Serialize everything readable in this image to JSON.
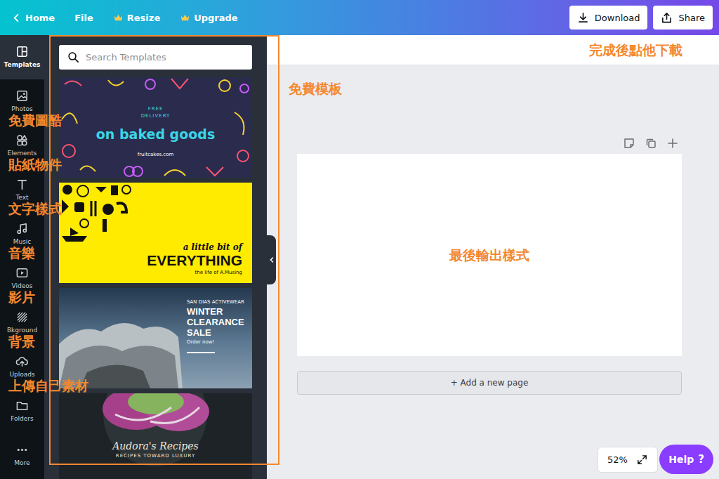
{
  "topbar": {
    "nav": [
      {
        "label": "Home",
        "kind": "back"
      },
      {
        "label": "File",
        "kind": "plain"
      },
      {
        "label": "Resize",
        "kind": "premium"
      },
      {
        "label": "Upgrade",
        "kind": "premium"
      }
    ],
    "actions": [
      {
        "label": "Download",
        "kind": "download"
      },
      {
        "label": "Share",
        "kind": "share"
      }
    ]
  },
  "sidebar": {
    "items": [
      {
        "label": "Templates",
        "selected": true
      },
      {
        "label": "Photos",
        "selected": false,
        "note": "免費圖酷"
      },
      {
        "label": "Elements",
        "selected": false,
        "note": "貼紙物件"
      },
      {
        "label": "Text",
        "selected": false,
        "note": "文字樣式"
      },
      {
        "label": "Music",
        "selected": false,
        "note": "音樂"
      },
      {
        "label": "Videos",
        "selected": false,
        "note": "影片"
      },
      {
        "label": "Bkground",
        "selected": false,
        "note": "背景"
      },
      {
        "label": "Uploads",
        "selected": false,
        "note": "上傳自己素材"
      },
      {
        "label": "Folders",
        "selected": false
      },
      {
        "label": "More",
        "selected": false
      }
    ]
  },
  "panel": {
    "search": {
      "placeholder": "Search Templates"
    },
    "templates": [
      {
        "kind": "pattern",
        "color": "#2a2b4d",
        "texts": [
          {
            "text": "FREE",
            "kind": "tiny"
          },
          {
            "text": "DELIVERY",
            "kind": "tiny"
          },
          {
            "text": "on baked goods",
            "kind": "headline"
          },
          {
            "text": "fruitcakes.com",
            "kind": "caption"
          }
        ]
      },
      {
        "kind": "icons",
        "color": "#ffeb00",
        "texts": [
          {
            "text": "a little bit of",
            "kind": "script"
          },
          {
            "text": "EVERYTHING",
            "kind": "headline"
          },
          {
            "text": "the life of A.Musing",
            "kind": "caption"
          }
        ]
      },
      {
        "kind": "photo-right",
        "color": "#3f5368",
        "texts": [
          {
            "text": "SAN DIAS ACTIVEWEAR",
            "kind": "tiny"
          },
          {
            "text": "WINTER",
            "kind": "headline"
          },
          {
            "text": "CLEARANCE",
            "kind": "headline"
          },
          {
            "text": "SALE",
            "kind": "headline"
          },
          {
            "text": "Order now!",
            "kind": "tiny"
          }
        ]
      },
      {
        "kind": "photo-bottom",
        "color": "#1d2327",
        "texts": [
          {
            "text": "Audora's Recipes",
            "kind": "script"
          },
          {
            "text": "RECIPES TOWARD LUXURY",
            "kind": "tiny"
          }
        ]
      }
    ]
  },
  "notes": {
    "panel": "免費模板",
    "download": "完成後點他下載",
    "page": "最後輸出樣式"
  },
  "canvas": {
    "add_page": "+ Add a new page"
  },
  "zoom": {
    "reading": "52%"
  },
  "help": {
    "label": "Help",
    "icon": "?"
  }
}
